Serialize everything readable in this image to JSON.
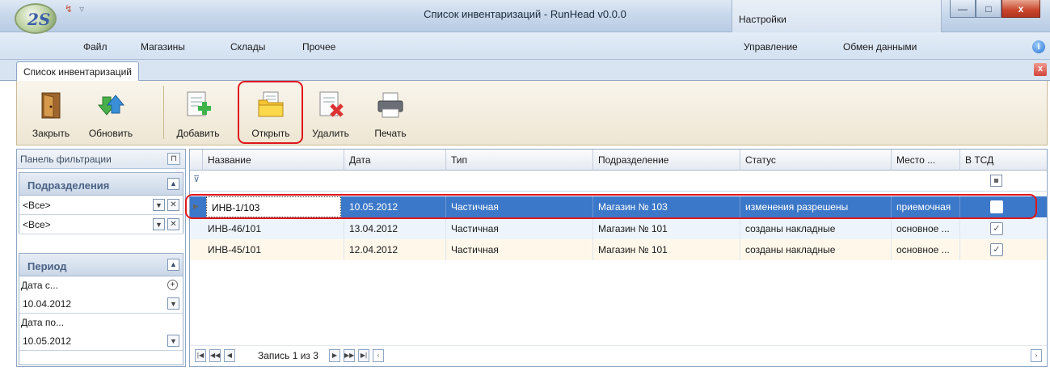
{
  "window": {
    "title": "Список инвентаризаций - RunHead v0.0.0",
    "context_tab": "Настройки",
    "minimize": "—",
    "maximize": "□",
    "close": "x"
  },
  "app_logo_text": "2S",
  "menu": {
    "items": [
      "Файл",
      "Магазины",
      "Склады",
      "Прочее"
    ],
    "right_items": [
      "Управление",
      "Обмен данными"
    ],
    "help": "i"
  },
  "document_tab": {
    "label": "Список инвентаризаций",
    "close": "x"
  },
  "toolbar": {
    "buttons": [
      {
        "label": "Закрыть",
        "icon": "door-exit-icon"
      },
      {
        "label": "Обновить",
        "icon": "refresh-arrows-icon"
      },
      {
        "label": "Добавить",
        "icon": "add-document-icon"
      },
      {
        "label": "Открыть",
        "icon": "open-folder-icon"
      },
      {
        "label": "Удалить",
        "icon": "delete-document-icon"
      },
      {
        "label": "Печать",
        "icon": "printer-icon"
      }
    ]
  },
  "filter_panel": {
    "title": "Панель фильтрации",
    "pin": "⊓",
    "departments": {
      "header": "Подразделения",
      "combo1": "<Все>",
      "combo2": "<Все>"
    },
    "period": {
      "header": "Период",
      "date_from_label": "Дата с...",
      "date_from": "10.04.2012",
      "date_to_label": "Дата по...",
      "date_to": "10.05.2012"
    }
  },
  "grid": {
    "columns": [
      "Название",
      "Дата",
      "Тип",
      "Подразделение",
      "Статус",
      "Место ...",
      "В ТСД"
    ],
    "rows": [
      {
        "name": "ИНВ-1/103",
        "date": "10.05.2012",
        "type": "Частичная",
        "department": "Магазин № 103",
        "status": "изменения разрешены",
        "place": "приемочная",
        "in_tsd": false
      },
      {
        "name": "ИНВ-46/101",
        "date": "13.04.2012",
        "type": "Частичная",
        "department": "Магазин № 101",
        "status": "созданы накладные",
        "place": "основное ...",
        "in_tsd": true
      },
      {
        "name": "ИНВ-45/101",
        "date": "12.04.2012",
        "type": "Частичная",
        "department": "Магазин № 101",
        "status": "созданы накладные",
        "place": "основное ...",
        "in_tsd": true
      }
    ],
    "navigator": "Запись 1 из 3"
  }
}
